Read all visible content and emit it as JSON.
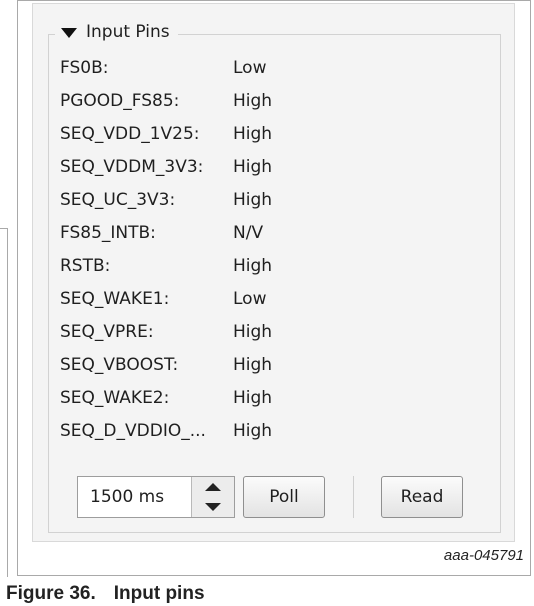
{
  "panel": {
    "title": "Input Pins",
    "pins": [
      {
        "name": "FS0B:",
        "value": "Low"
      },
      {
        "name": "PGOOD_FS85:",
        "value": "High"
      },
      {
        "name": "SEQ_VDD_1V25:",
        "value": "High"
      },
      {
        "name": "SEQ_VDDM_3V3:",
        "value": "High"
      },
      {
        "name": "SEQ_UC_3V3:",
        "value": "High"
      },
      {
        "name": "FS85_INTB:",
        "value": "N/V"
      },
      {
        "name": "RSTB:",
        "value": "High"
      },
      {
        "name": "SEQ_WAKE1:",
        "value": "Low"
      },
      {
        "name": "SEQ_VPRE:",
        "value": "High"
      },
      {
        "name": "SEQ_VBOOST:",
        "value": "High"
      },
      {
        "name": "SEQ_WAKE2:",
        "value": "High"
      },
      {
        "name": "SEQ_D_VDDIO_...",
        "value": "High"
      }
    ],
    "interval": "1500 ms",
    "poll_label": "Poll",
    "read_label": "Read"
  },
  "figure": {
    "reference": "aaa-045791",
    "number": "Figure 36.",
    "title": "Input pins"
  }
}
